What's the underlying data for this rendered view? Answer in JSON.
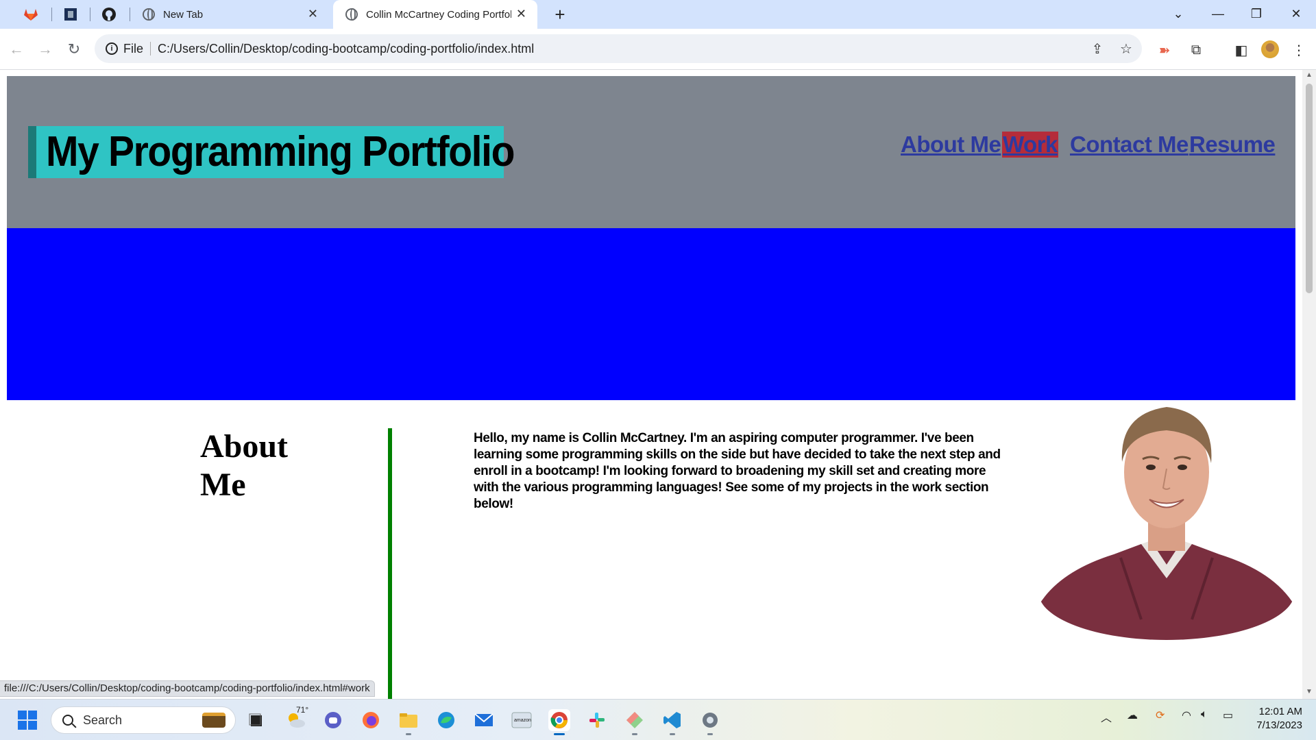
{
  "browser": {
    "tabs": [
      {
        "label": "New Tab",
        "active": false
      },
      {
        "label": "Collin McCartney Coding Portfolio",
        "active": true
      }
    ],
    "pinned_tabs": [
      "gitlab-icon",
      "portfolio-app-icon",
      "github-icon"
    ],
    "address": {
      "scheme_label": "File",
      "url": "C:/Users/Collin/Desktop/coding-bootcamp/coding-portfolio/index.html"
    },
    "status_url": "file:///C:/Users/Collin/Desktop/coding-bootcamp/coding-portfolio/index.html#work"
  },
  "site": {
    "title": "My Programming Portfolio",
    "nav": [
      {
        "label": "About Me",
        "hover": false
      },
      {
        "label": "Work",
        "hover": true
      },
      {
        "label": "Contact Me",
        "hover": false
      },
      {
        "label": "Resume",
        "hover": false
      }
    ],
    "about": {
      "heading": "About Me",
      "text": "Hello, my name is Collin McCartney. I'm an aspiring computer programmer. I've been learning some programming skills on the side but have decided to take the next step and enroll in a bootcamp! I'm looking forward to broadening my skill set and creating more with the various programming languages! See some of my projects in the work section below!"
    },
    "colors": {
      "header_bg": "#7e858f",
      "title_bg": "#2fc4c4",
      "hero_bg": "#0000ff",
      "divider": "#008000",
      "nav_link": "#2d3a9f",
      "nav_hover_bg": "#b52c3a"
    }
  },
  "taskbar": {
    "search_placeholder": "Search",
    "weather_temp": "71°",
    "apps": [
      "file-explorer-icon",
      "weather-icon",
      "teams-icon",
      "firefox-icon",
      "folder-icon",
      "edge-icon",
      "mail-icon",
      "amazon-icon",
      "chrome-icon",
      "slack-icon",
      "git-icon",
      "vscode-icon",
      "settings-icon"
    ],
    "time": "12:01 AM",
    "date": "7/13/2023"
  }
}
